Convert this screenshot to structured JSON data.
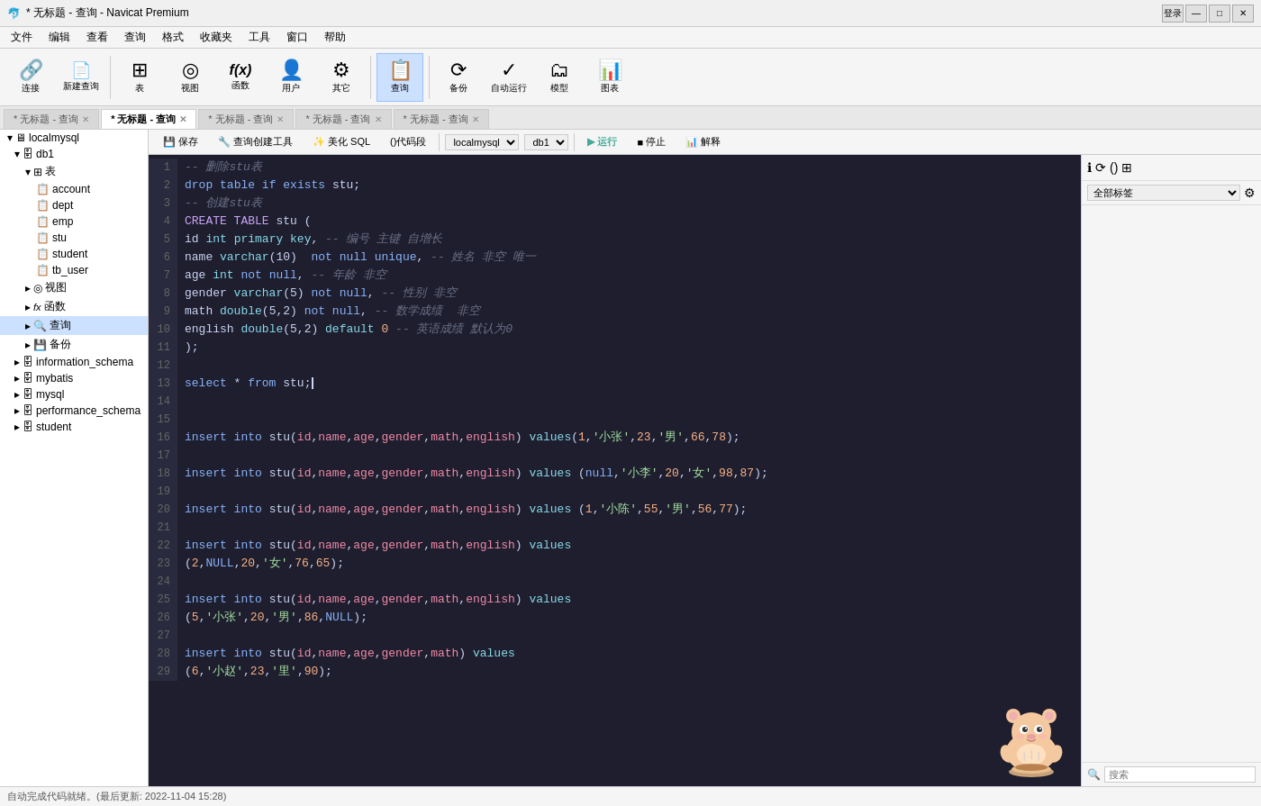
{
  "title_bar": {
    "title": "* 无标题 - 查询 - Navicat Premium",
    "login": "登录",
    "min": "—",
    "max": "□",
    "close": "✕"
  },
  "menu": {
    "items": [
      "文件",
      "编辑",
      "查看",
      "查询",
      "格式",
      "收藏夹",
      "工具",
      "窗口",
      "帮助"
    ]
  },
  "toolbar": {
    "items": [
      {
        "label": "连接",
        "icon": "🔗"
      },
      {
        "label": "新建查询",
        "icon": "📄"
      },
      {
        "label": "表",
        "icon": "⊞"
      },
      {
        "label": "视图",
        "icon": "◎"
      },
      {
        "label": "函数",
        "icon": "fx"
      },
      {
        "label": "用户",
        "icon": "👤"
      },
      {
        "label": "其它",
        "icon": "⚙"
      },
      {
        "label": "查询",
        "icon": "📋",
        "active": true
      },
      {
        "label": "备份",
        "icon": "⟳"
      },
      {
        "label": "自动运行",
        "icon": "✓"
      },
      {
        "label": "模型",
        "icon": "🗂"
      },
      {
        "label": "图表",
        "icon": "📊"
      }
    ]
  },
  "tabs": [
    {
      "label": "* 无标题 - 查询",
      "active": false
    },
    {
      "label": "* 无标题 - 查询",
      "active": true
    },
    {
      "label": "* 无标题 - 查询",
      "active": false
    },
    {
      "label": "* 无标题 - 查询",
      "active": false
    },
    {
      "label": "* 无标题 - 查询",
      "active": false
    }
  ],
  "sidebar": {
    "localmysql": "localmysql",
    "db1": "db1",
    "tables_label": "表",
    "tables": [
      "account",
      "dept",
      "emp",
      "stu",
      "student",
      "tb_user"
    ],
    "views": "视图",
    "functions": "函数",
    "queries": "查询",
    "backups": "备份",
    "other_dbs": [
      "information_schema",
      "mybatis",
      "mysql",
      "performance_schema",
      "student"
    ]
  },
  "query_toolbar": {
    "save": "保存",
    "create_query": "查询创建工具",
    "beautify": "美化 SQL",
    "code_snippet": "()代码段",
    "db_selector": "localmysql",
    "db2_selector": "db1",
    "run": "运行",
    "stop": "停止",
    "explain": "解释"
  },
  "tag_area": {
    "label": "全部标签"
  },
  "code_lines": [
    {
      "num": "1",
      "content": "-- 删除stu表"
    },
    {
      "num": "2",
      "content": "drop table if exists stu;"
    },
    {
      "num": "3",
      "content": "-- 创建stu表"
    },
    {
      "num": "4",
      "content": "CREATE TABLE stu ("
    },
    {
      "num": "5",
      "content": "id int primary key, -- 编号 主键 自增长"
    },
    {
      "num": "6",
      "content": "name varchar(10)  not null unique, -- 姓名 非空 唯一"
    },
    {
      "num": "7",
      "content": "age int not null, -- 年龄 非空"
    },
    {
      "num": "8",
      "content": "gender varchar(5) not null, -- 性别 非空"
    },
    {
      "num": "9",
      "content": "math double(5,2) not null, -- 数学成绩  非空"
    },
    {
      "num": "10",
      "content": "english double(5,2) default 0 -- 英语成绩 默认为0"
    },
    {
      "num": "11",
      "content": ");"
    },
    {
      "num": "12",
      "content": ""
    },
    {
      "num": "13",
      "content": "select * from stu;"
    },
    {
      "num": "14",
      "content": ""
    },
    {
      "num": "15",
      "content": ""
    },
    {
      "num": "16",
      "content": "insert into stu(id,name,age,gender,math,english) values(1,'小张',23,'男',66,78);"
    },
    {
      "num": "17",
      "content": ""
    },
    {
      "num": "18",
      "content": "insert into stu(id,name,age,gender,math,english) values (null,'小李',20,'女',98,87);"
    },
    {
      "num": "19",
      "content": ""
    },
    {
      "num": "20",
      "content": "insert into stu(id,name,age,gender,math,english) values (1,'小陈',55,'男',56,77);"
    },
    {
      "num": "21",
      "content": ""
    },
    {
      "num": "22",
      "content": "insert into stu(id,name,age,gender,math,english) values"
    },
    {
      "num": "23",
      "content": "(2,NULL,20,'女',76,65);"
    },
    {
      "num": "24",
      "content": ""
    },
    {
      "num": "25",
      "content": "insert into stu(id,name,age,gender,math,english) values"
    },
    {
      "num": "26",
      "content": "(5,'小张',20,'男',86,NULL);"
    },
    {
      "num": "27",
      "content": ""
    },
    {
      "num": "28",
      "content": "insert into stu(id,name,age,gender,math) values"
    },
    {
      "num": "29",
      "content": "(6,'小赵',23,'里',90);"
    }
  ],
  "status_bar": {
    "text": "自动完成代码就绪。(最后更新: 2022-11-04 15:28)"
  },
  "right_panel": {
    "search_placeholder": "搜索"
  }
}
